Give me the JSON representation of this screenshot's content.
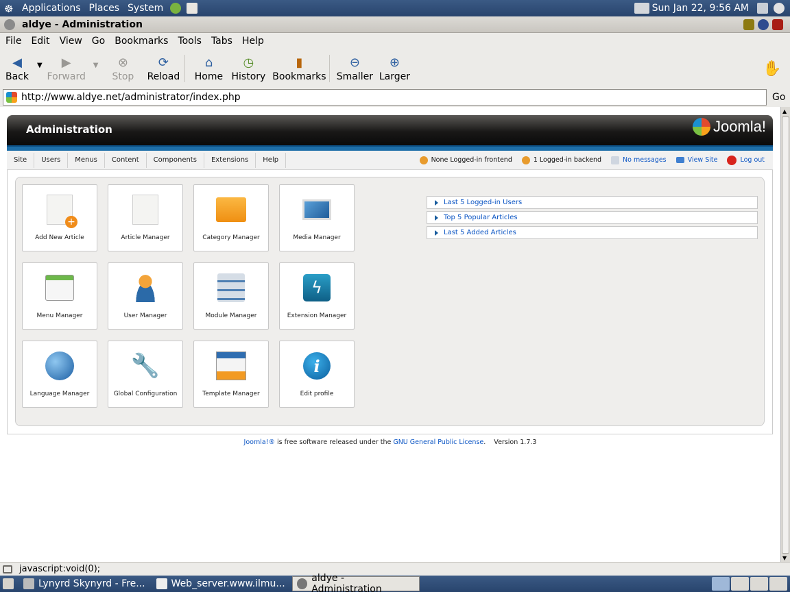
{
  "gnome_panel": {
    "menus": [
      "Applications",
      "Places",
      "System"
    ],
    "clock": "Sun Jan 22,  9:56 AM"
  },
  "window": {
    "title": "aldye - Administration"
  },
  "menubar": [
    "File",
    "Edit",
    "View",
    "Go",
    "Bookmarks",
    "Tools",
    "Tabs",
    "Help"
  ],
  "toolbar": {
    "back": "Back",
    "forward": "Forward",
    "stop": "Stop",
    "reload": "Reload",
    "home": "Home",
    "history": "History",
    "bookmarks": "Bookmarks",
    "smaller": "Smaller",
    "larger": "Larger"
  },
  "urlbar": {
    "url": "http://www.aldye.net/administrator/index.php",
    "go": "Go"
  },
  "joomla": {
    "header_title": "Administration",
    "logo_text": "Joomla!",
    "menu": [
      "Site",
      "Users",
      "Menus",
      "Content",
      "Components",
      "Extensions",
      "Help"
    ],
    "status": {
      "frontend": "None Logged-in frontend",
      "backend": "1 Logged-in backend",
      "messages": "No messages",
      "view_site": "View Site",
      "logout": "Log out"
    },
    "tiles": [
      {
        "label": "Add New Article",
        "icon": "add-article-icon"
      },
      {
        "label": "Article Manager",
        "icon": "article-icon"
      },
      {
        "label": "Category Manager",
        "icon": "folder-icon"
      },
      {
        "label": "Media Manager",
        "icon": "media-icon"
      },
      {
        "label": "Menu Manager",
        "icon": "menu-icon"
      },
      {
        "label": "User Manager",
        "icon": "user-icon"
      },
      {
        "label": "Module Manager",
        "icon": "module-icon"
      },
      {
        "label": "Extension Manager",
        "icon": "extension-icon"
      },
      {
        "label": "Language Manager",
        "icon": "globe-icon"
      },
      {
        "label": "Global Configuration",
        "icon": "tools-icon"
      },
      {
        "label": "Template Manager",
        "icon": "template-icon"
      },
      {
        "label": "Edit profile",
        "icon": "info-icon"
      }
    ],
    "panels": [
      "Last 5 Logged-in Users",
      "Top 5 Popular Articles",
      "Last 5 Added Articles"
    ],
    "footer": {
      "joomla": "Joomla!®",
      "text": " is free software released under the ",
      "license": "GNU General Public License",
      "version": ".    Version 1.7.3"
    }
  },
  "statusbar": {
    "text": "javascript:void(0);"
  },
  "taskbar": [
    {
      "label": "Lynyrd Skynyrd - Fre..."
    },
    {
      "label": "Web_server.www.ilmu..."
    },
    {
      "label": "aldye - Administration",
      "active": true
    }
  ]
}
